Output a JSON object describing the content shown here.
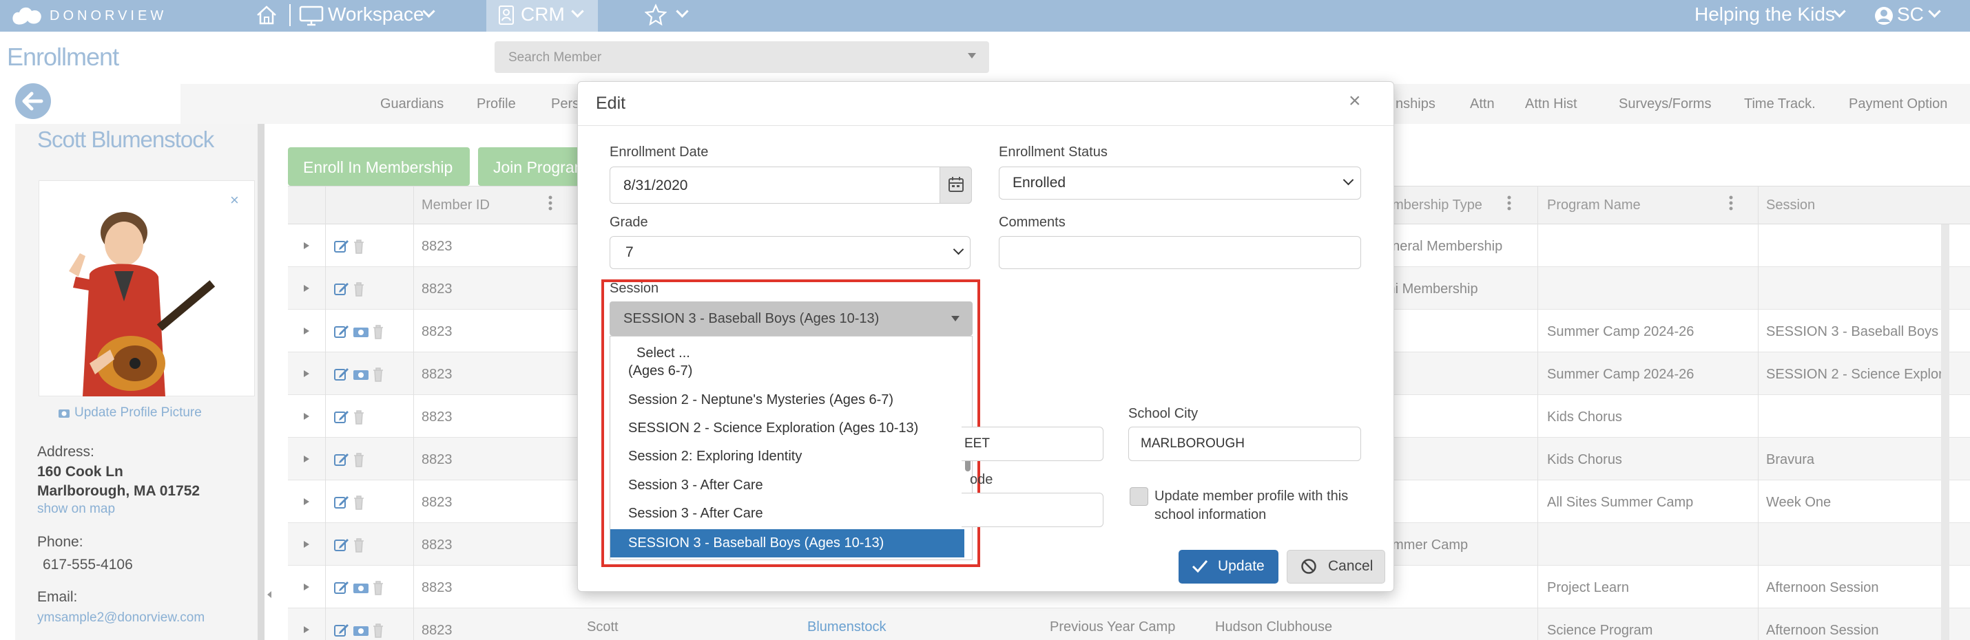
{
  "app": {
    "logo_text": "DONORVIEW",
    "workspace_label": "Workspace",
    "crm_label": "CRM",
    "org_label": "Helping the Kids",
    "user_initials": "SC"
  },
  "page": {
    "title": "Enrollment",
    "search_placeholder": "Search Member"
  },
  "tabs": [
    "Guardians",
    "Profile",
    "Pers",
    "nships",
    "Attn",
    "Attn Hist",
    "Surveys/Forms",
    "Time Track.",
    "Payment Option"
  ],
  "member": {
    "name": "Scott Blumenstock",
    "update_picture": "Update Profile Picture",
    "address_label": "Address:",
    "address_line1": "160 Cook Ln",
    "address_line2": "Marlborough, MA 01752",
    "map_link": "show on map",
    "phone_label": "Phone:",
    "phone": "617-555-4106",
    "email_label": "Email:",
    "email": "ymsample2@donorview.com"
  },
  "actions": {
    "enroll_membership": "Enroll In Membership",
    "join_program": "Join Program"
  },
  "grid": {
    "headers": {
      "member_id": "Member ID",
      "membership_type": "embership Type",
      "program_name": "Program Name",
      "session": "Session"
    },
    "rows": [
      {
        "id": "8823",
        "membership": "eneral Membership",
        "program": "",
        "session": ""
      },
      {
        "id": "8823",
        "membership": "ini Membership",
        "program": "",
        "session": ""
      },
      {
        "id": "8823",
        "membership": "",
        "program": "Summer Camp 2024-26",
        "session": "SESSION 3 - Baseball Boys"
      },
      {
        "id": "8823",
        "membership": "",
        "program": "Summer Camp 2024-26",
        "session": "SESSION 2 - Science Explor"
      },
      {
        "id": "8823",
        "membership": "",
        "program": "Kids Chorus",
        "session": ""
      },
      {
        "id": "8823",
        "membership": "",
        "program": "Kids Chorus",
        "session": "Bravura"
      },
      {
        "id": "8823",
        "membership": "",
        "program": "All Sites Summer Camp",
        "session": "Week One"
      },
      {
        "id": "8823",
        "membership": "ummer Camp",
        "program": "",
        "session": ""
      },
      {
        "id": "8823",
        "membership": "",
        "program": "Project Learn",
        "session": "Afternoon Session"
      },
      {
        "id": "8823",
        "membership": "",
        "program": "Science Program",
        "session": "Afternoon Session"
      }
    ],
    "last_row": {
      "first_name": "Scott",
      "last_name": "Blumenstock",
      "membership": "Previous Year Camp",
      "location": "Hudson Clubhouse"
    }
  },
  "modal": {
    "title": "Edit",
    "enrollment_date_label": "Enrollment Date",
    "enrollment_date": "8/31/2020",
    "enrollment_status_label": "Enrollment Status",
    "enrollment_status": "Enrolled",
    "grade_label": "Grade",
    "grade": "7",
    "comments_label": "Comments",
    "comments": "",
    "session_label": "Session",
    "session_selected": "SESSION 3 - Baseball Boys (Ages 10-13)",
    "session_options": [
      "Select ...",
      "(Ages 6-7)",
      "Session 2 - Neptune's Mysteries (Ages 6-7)",
      "SESSION 2 - Science Exploration (Ages 10-13)",
      "Session 2: Exploring Identity",
      "Session 3 - After Care",
      "Session 3 - After Care",
      "SESSION 3 - Baseball Boys (Ages 10-13)"
    ],
    "school_city_label": "School City",
    "school_city": "MARLBOROUGH",
    "partial_street": "EET",
    "partial_code_label": "ode",
    "update_profile_checkbox_label1": "Update member profile with this",
    "update_profile_checkbox_label2": "school information",
    "update_button": "Update",
    "cancel_button": "Cancel"
  },
  "colors": {
    "topbar": "#9fbcd9",
    "accent": "#2f6fb0",
    "highlight_border": "#e0352b",
    "green_button": "#a8d5a5"
  }
}
